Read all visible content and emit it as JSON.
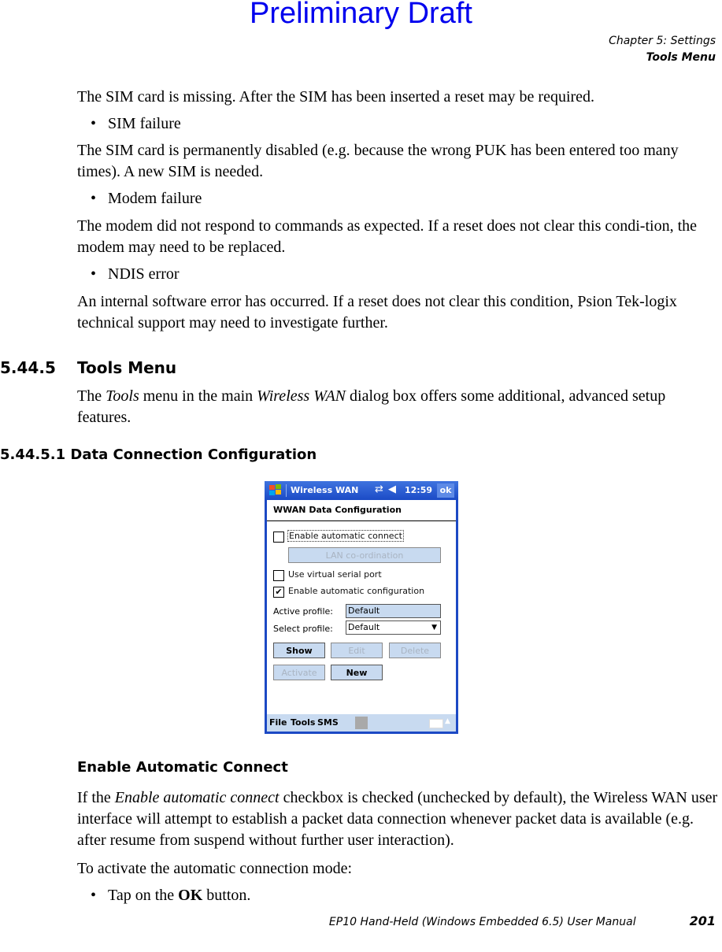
{
  "watermark": "Preliminary Draft",
  "header": {
    "chapter": "Chapter 5:  Settings",
    "section": "Tools Menu"
  },
  "body": {
    "p1": "The SIM card is missing. After the SIM has been inserted a reset may be required.",
    "bullet1": "SIM failure",
    "p2": "The SIM card is permanently disabled (e.g. because the wrong PUK has been entered too many times). A new SIM is needed.",
    "bullet2": "Modem failure",
    "p3": "The modem did not respond to commands as expected. If a reset does not clear this condi-tion, the modem may need to be replaced.",
    "bullet3": "NDIS error",
    "p4": "An internal software error has occurred. If a reset does not clear this condition, Psion Tek-logix technical support may need to investigate further.",
    "h_num": "5.44.5",
    "h_title": "Tools Menu",
    "p5_a": "The ",
    "p5_tools": "Tools",
    "p5_b": " menu in the main ",
    "p5_wwan": "Wireless WAN",
    "p5_c": " dialog box offers some additional, advanced setup features.",
    "h3": "5.44.5.1  Data Connection Configuration",
    "h4": "Enable Automatic Connect",
    "p6_a": "If the ",
    "p6_em": "Enable automatic connect",
    "p6_b": " checkbox is checked (unchecked by default), the Wireless WAN user interface will attempt to establish a packet data connection whenever packet data is available (e.g. after resume from suspend without further user interaction).",
    "p7": "To activate the automatic connection mode:",
    "bullet4_a": "Tap on the ",
    "bullet4_b": "OK",
    "bullet4_c": " button.",
    "bullet_char": "•"
  },
  "device": {
    "title": "Wireless WAN",
    "time": "12:59",
    "ok": "ok",
    "dialog_title": "WWAN Data Configuration",
    "cb_auto_connect": {
      "label": "Enable automatic connect",
      "checked": false
    },
    "btn_lan": "LAN co-ordination",
    "cb_virtual_serial": {
      "label": "Use virtual serial port",
      "checked": false
    },
    "cb_auto_config": {
      "label": "Enable automatic configuration",
      "checked": true,
      "mark": "✔"
    },
    "active_profile_label": "Active profile:",
    "active_profile_value": "Default",
    "select_profile_label": "Select profile:",
    "select_profile_value": "Default",
    "btn_show": "Show",
    "btn_edit": "Edit",
    "btn_delete": "Delete",
    "btn_activate": "Activate",
    "btn_new": "New",
    "menu": [
      "File",
      "Tools",
      "SMS"
    ]
  },
  "footer": {
    "manual": "EP10 Hand-Held (Windows Embedded 6.5) User Manual",
    "page": "201"
  }
}
